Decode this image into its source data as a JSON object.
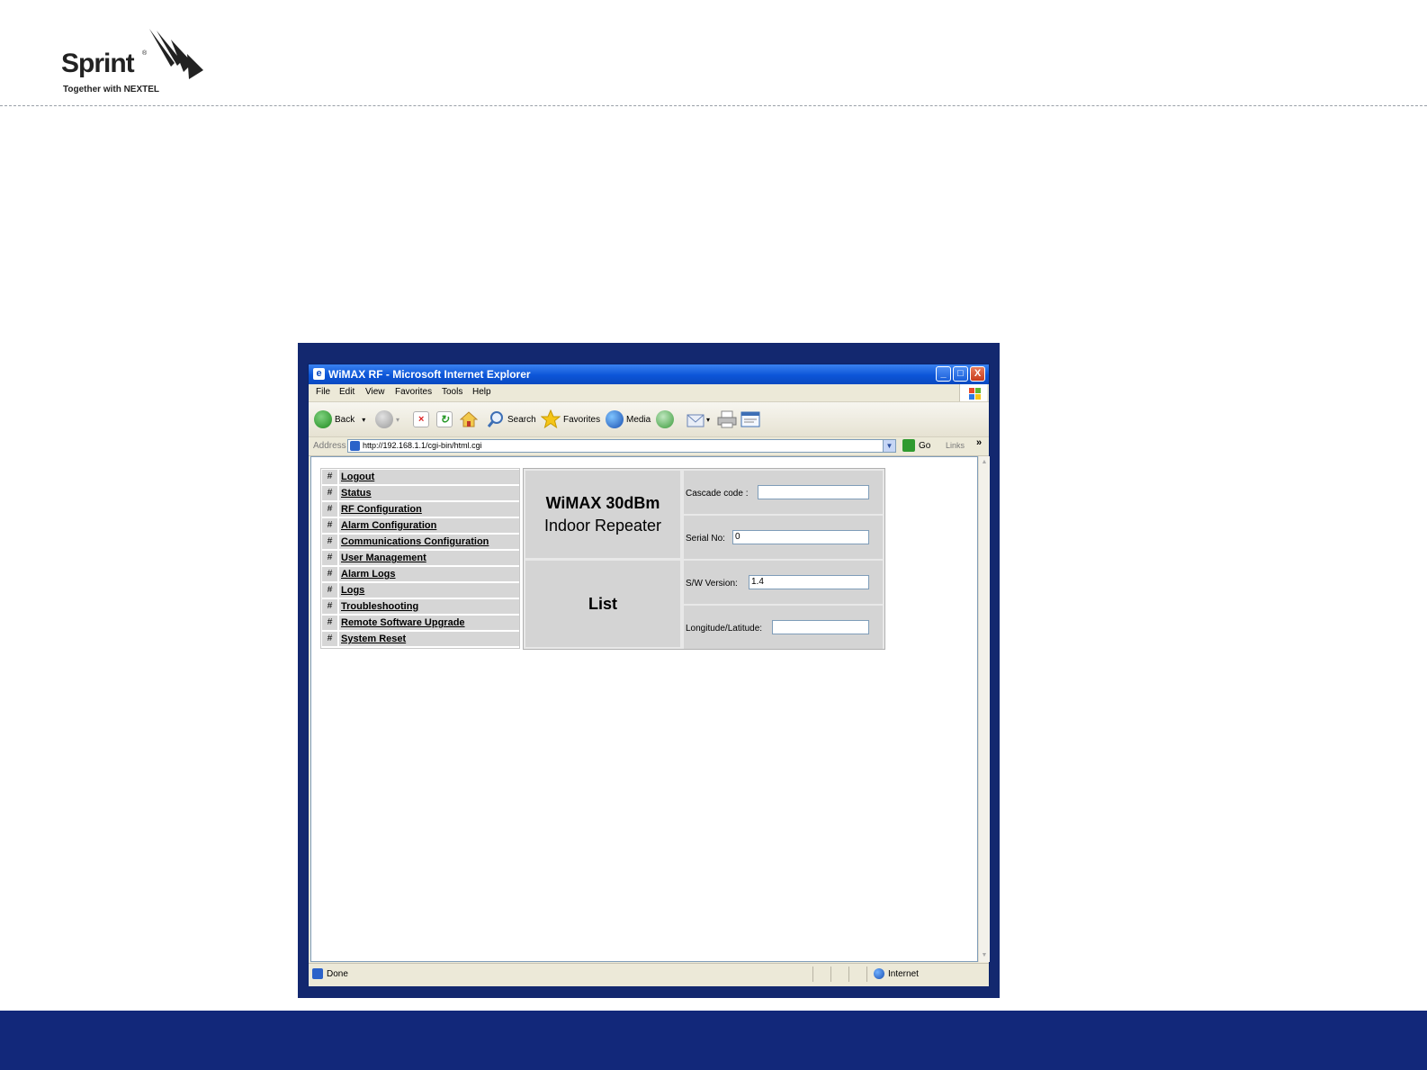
{
  "brand": {
    "name": "Sprint",
    "tagline": "Together with NEXTEL"
  },
  "window": {
    "title": "WiMAX RF - Microsoft Internet Explorer",
    "controls": [
      "_",
      "□",
      "X"
    ]
  },
  "menu": [
    "File",
    "Edit",
    "View",
    "Favorites",
    "Tools",
    "Help"
  ],
  "toolbar": {
    "back_label": "Back",
    "search_label": "Search",
    "favorites_label": "Favorites",
    "media_label": "Media"
  },
  "address": {
    "label": "Address",
    "url": "http://192.168.1.1/cgi-bin/html.cgi",
    "go_label": "Go",
    "links_label": "Links",
    "chevron": "»"
  },
  "nav": {
    "bullet": "#",
    "items": [
      "Logout",
      "Status",
      "RF Configuration",
      "Alarm Configuration",
      "Communications Configuration",
      "User Management",
      "Alarm Logs",
      "Logs",
      "Troubleshooting",
      "Remote Software Upgrade",
      "System Reset"
    ]
  },
  "device": {
    "title_line1": "WiMAX 30dBm",
    "title_line2": "Indoor Repeater",
    "list_label": "List",
    "fields": {
      "cascade_label": "Cascade code :",
      "cascade_value": "",
      "serial_label": "Serial No:",
      "serial_value": "0",
      "sw_label": "S/W Version:",
      "sw_value": "1.4",
      "lonlat_label": "Longitude/Latitude:",
      "lonlat_value": ""
    }
  },
  "status": {
    "text": "Done",
    "zone": "Internet"
  }
}
